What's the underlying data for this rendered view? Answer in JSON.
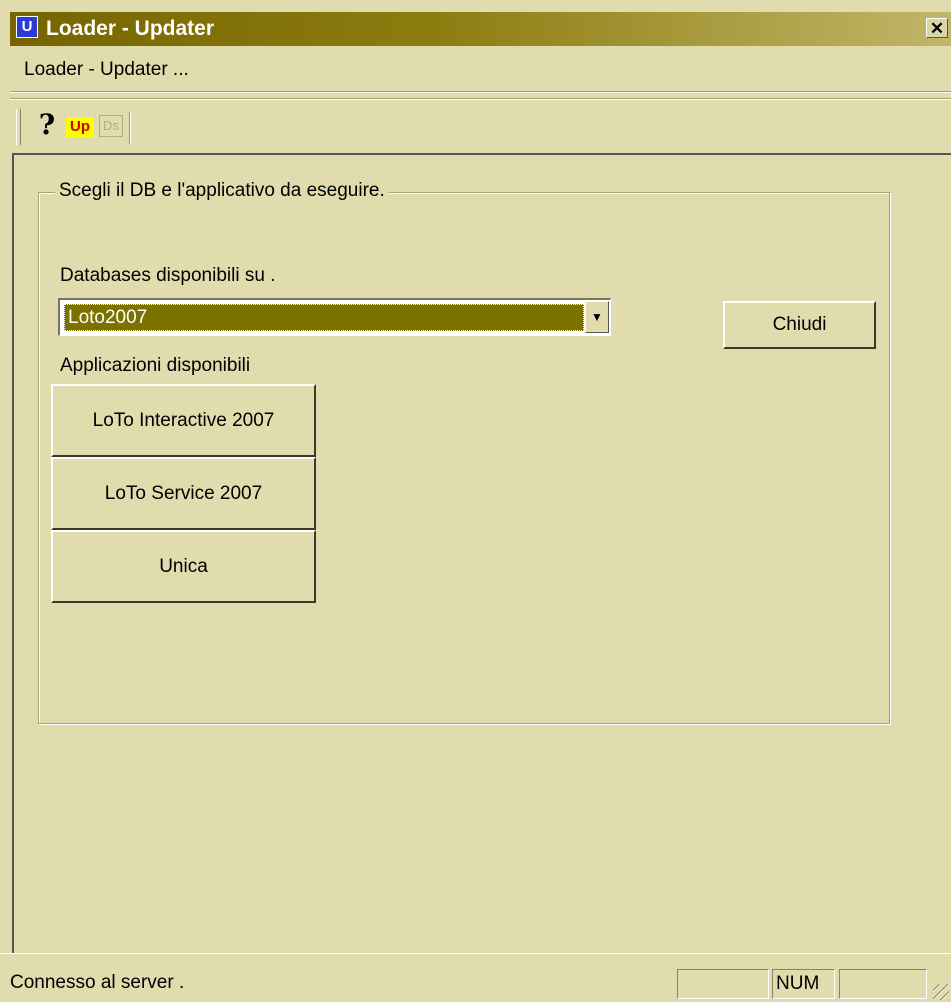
{
  "window": {
    "title": "Loader - Updater",
    "app_icon_letter": "U",
    "close_symbol": "✕"
  },
  "menu": {
    "items": [
      "Loader - Updater ..."
    ]
  },
  "toolbar": {
    "help_icon": "question-mark",
    "help_glyph": "?",
    "up_label": "Up",
    "ds_label": "Ds"
  },
  "group": {
    "legend": "Scegli il DB e l'applicativo da eseguire.",
    "db_label": "Databases disponibili su .",
    "db_selected": "Loto2007",
    "close_button": "Chiudi",
    "apps_label": "Applicazioni disponibili",
    "apps": [
      "LoTo Interactive 2007",
      "LoTo Service 2007",
      "Unica"
    ]
  },
  "status": {
    "text": "Connesso al server .",
    "panel1": "",
    "panel2": "NUM",
    "panel3": ""
  },
  "colors": {
    "background": "#e0dcae",
    "titlebar": "#776400",
    "selection": "#7c7200"
  }
}
